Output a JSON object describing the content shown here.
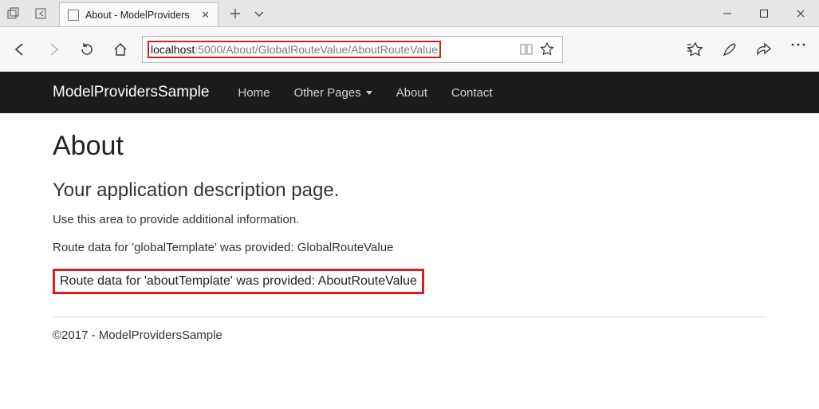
{
  "window": {
    "tab_title": "About - ModelProviders"
  },
  "address": {
    "host": "localhost",
    "path": ":5000/About/GlobalRouteValue/AboutRouteValue"
  },
  "nav": {
    "brand": "ModelProvidersSample",
    "home": "Home",
    "other": "Other Pages",
    "about": "About",
    "contact": "Contact"
  },
  "content": {
    "title": "About",
    "subtitle": "Your application description page.",
    "desc": "Use this area to provide additional information.",
    "route_global": "Route data for 'globalTemplate' was provided: GlobalRouteValue",
    "route_about": "Route data for 'aboutTemplate' was provided: AboutRouteValue"
  },
  "footer": {
    "text": "©2017 - ModelProvidersSample"
  }
}
